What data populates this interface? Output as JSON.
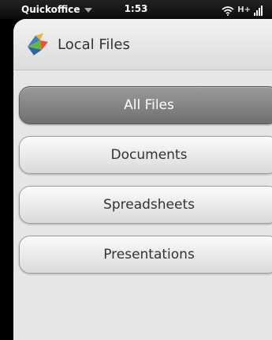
{
  "status_bar": {
    "app_name": "Quickoffice",
    "time": "1:53",
    "network": "H+",
    "icons": [
      "chevron-down-icon",
      "wifi-icon",
      "signal-icon"
    ]
  },
  "header": {
    "title": "Local Files",
    "logo_icon": "quickoffice-logo-icon"
  },
  "menu": {
    "items": [
      {
        "label": "All Files",
        "selected": true
      },
      {
        "label": "Documents",
        "selected": false
      },
      {
        "label": "Spreadsheets",
        "selected": false
      },
      {
        "label": "Presentations",
        "selected": false
      }
    ]
  },
  "colors": {
    "selected_button": "#858585",
    "button": "#eeeeee",
    "background": "#e6e6e6",
    "status_bar": "#111111"
  }
}
